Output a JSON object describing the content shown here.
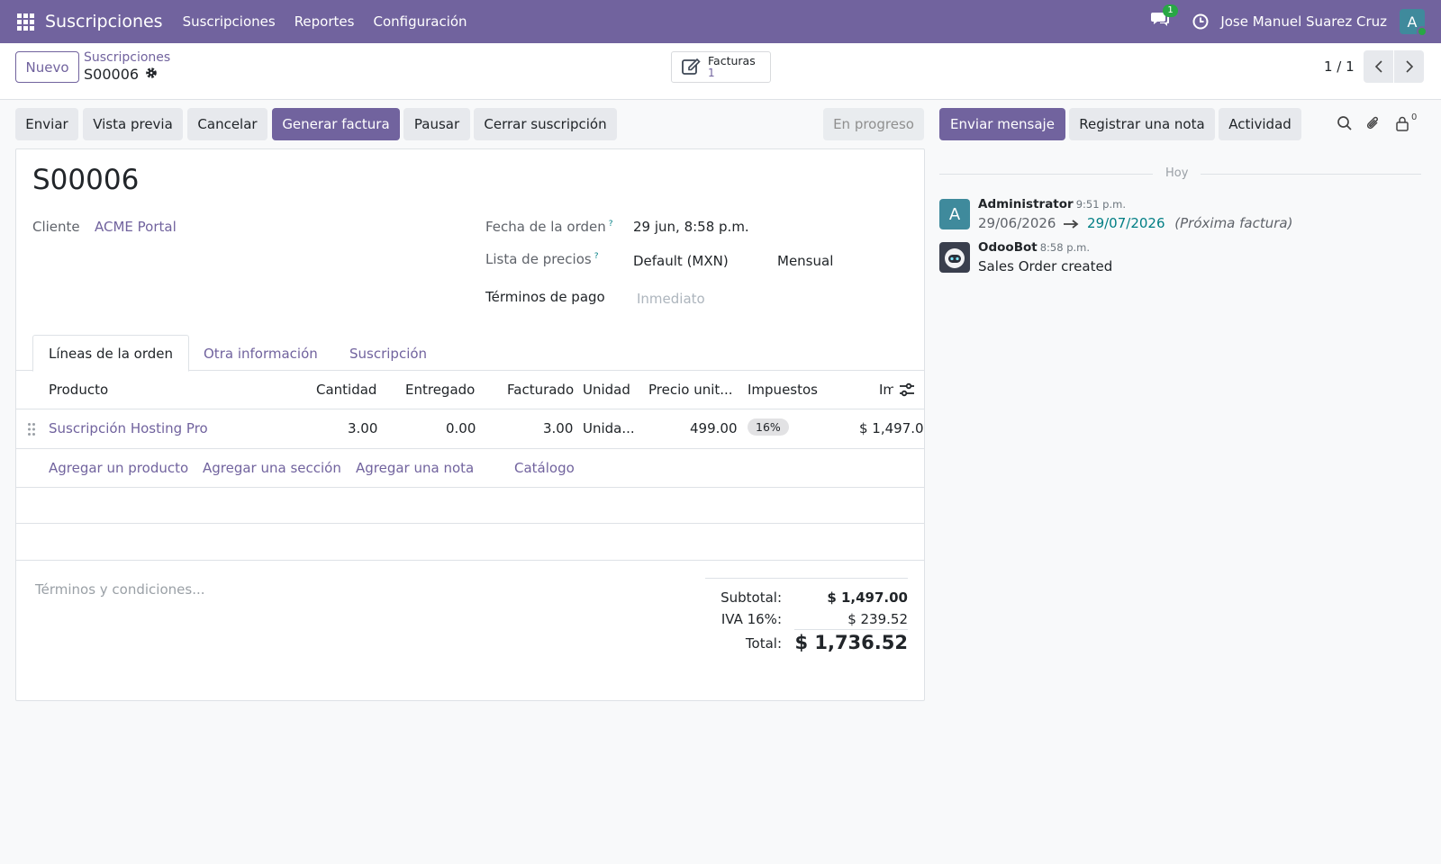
{
  "navbar": {
    "app_title": "Suscripciones",
    "menu": [
      "Suscripciones",
      "Reportes",
      "Configuración"
    ],
    "chat_count": "1",
    "user_name": "Jose Manuel Suarez Cruz",
    "avatar_letter": "A",
    "brand_color": "#71639e"
  },
  "control": {
    "new_label": "Nuevo",
    "breadcrumb_parent": "Suscripciones",
    "breadcrumb_current": "S00006",
    "stat_button": {
      "label": "Facturas",
      "value": "1"
    },
    "pager": "1 / 1"
  },
  "statusbar": {
    "buttons": [
      "Enviar",
      "Vista previa",
      "Cancelar",
      "Generar factura",
      "Pausar",
      "Cerrar suscripción"
    ],
    "status": "En progreso"
  },
  "chatter_buttons": {
    "send_message": "Enviar mensaje",
    "log_note": "Registrar una nota",
    "activity": "Actividad",
    "followers_count": "0"
  },
  "record": {
    "title": "S00006",
    "customer_label": "Cliente",
    "customer_value": "ACME Portal",
    "order_date_label": "Fecha de la orden",
    "order_date_value": "29 jun, 8:58 p.m.",
    "pricelist_label": "Lista de precios",
    "pricelist_value": "Default (MXN)",
    "recurrence_value": "Mensual",
    "payment_terms_label": "Términos de pago",
    "payment_terms_placeholder": "Inmediato",
    "help_mark": "?"
  },
  "tabs": [
    "Líneas de la orden",
    "Otra información",
    "Suscripción"
  ],
  "table": {
    "headers": [
      "Producto",
      "Cantidad",
      "Entregado",
      "Facturado",
      "Unidad",
      "Precio unit...",
      "Impuestos",
      "Im"
    ],
    "rows": [
      {
        "product": "Suscripción Hosting Pro",
        "qty": "3.00",
        "delivered": "0.00",
        "invoiced": "3.00",
        "unit": "Unida...",
        "price": "499.00",
        "tax": "16%",
        "amount": "$ 1,497.0"
      }
    ],
    "add_actions": [
      "Agregar un producto",
      "Agregar una sección",
      "Agregar una nota",
      "Catálogo"
    ]
  },
  "footer": {
    "terms_placeholder": "Términos y condiciones...",
    "subtotal_label": "Subtotal:",
    "subtotal_value": "$ 1,497.00",
    "tax_label": "IVA 16%:",
    "tax_value": "$ 239.52",
    "total_label": "Total:",
    "total_value": "$ 1,736.52"
  },
  "chatter": {
    "date_separator": "Hoy",
    "messages": [
      {
        "author": "Administrator",
        "time": "9:51 p.m.",
        "old_date": "29/06/2026",
        "new_date": "29/07/2026",
        "field": "(Próxima factura)",
        "avatar": "A"
      },
      {
        "author": "OdooBot",
        "time": "8:58 p.m.",
        "body": "Sales Order created"
      }
    ]
  }
}
